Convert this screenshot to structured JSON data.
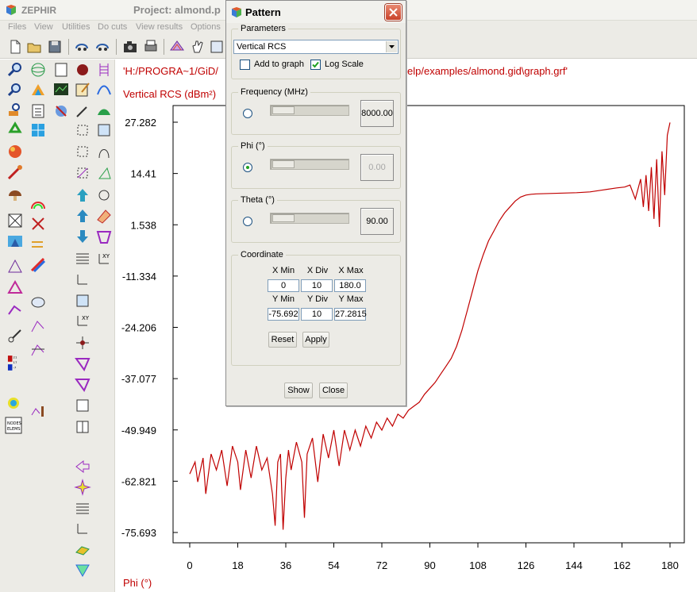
{
  "app": {
    "name": "ZEPHIR",
    "project_title": "Project: almond.p"
  },
  "menu": [
    "Files",
    "View",
    "Utilities",
    "Do cuts",
    "View results",
    "Options"
  ],
  "graph": {
    "path_prefix": "'H:/PROGRA~1/GiD/",
    "path_suffix": "elp/examples/almond.gid\\graph.grf'",
    "ylabel": "Vertical RCS (dBm²)",
    "xlabel": "Phi (°)",
    "line_color": "#c00000"
  },
  "dialog": {
    "title": "Pattern",
    "parameters_label": "Parameters",
    "parameter_selected": "Vertical RCS",
    "add_to_graph_label": "Add to graph",
    "add_to_graph_checked": false,
    "log_scale_label": "Log Scale",
    "log_scale_checked": true,
    "frequency_label": "Frequency (MHz)",
    "frequency_value": "8000.00",
    "phi_label": "Phi (°)",
    "phi_value": "0.00",
    "theta_label": "Theta (°)",
    "theta_value": "90.00",
    "coordinate_label": "Coordinate",
    "xmin_label": "X Min",
    "xdiv_label": "X Div",
    "xmax_label": "X Max",
    "xmin": "0",
    "xdiv": "10",
    "xmax": "180.0",
    "ymin_label": "Y Min",
    "ydiv_label": "Y Div",
    "ymax_label": "Y Max",
    "ymin": "-75.692",
    "ydiv": "10",
    "ymax": "27.2815",
    "reset_label": "Reset",
    "apply_label": "Apply",
    "show_label": "Show",
    "close_label": "Close"
  },
  "chart_data": {
    "type": "line",
    "title": "",
    "xlabel": "Phi (°)",
    "ylabel": "Vertical RCS (dBm²)",
    "xlim": [
      0,
      180
    ],
    "ylim": [
      -75.693,
      27.282
    ],
    "x_ticks": [
      "0",
      "18",
      "36",
      "54",
      "72",
      "90",
      "108",
      "126",
      "144",
      "162",
      "180"
    ],
    "y_ticks": [
      "27.282",
      "14.41",
      "1.538",
      "-11.334",
      "-24.206",
      "-37.077",
      "-49.949",
      "-62.821",
      "-75.693"
    ],
    "grid": false,
    "series": [
      {
        "color": "#c00000",
        "x": [
          0,
          2,
          3,
          5,
          6,
          8,
          10,
          12,
          14,
          16,
          18,
          19,
          21,
          23,
          25,
          27,
          29,
          31,
          32,
          33,
          34,
          35,
          36,
          37,
          38,
          40,
          42,
          43,
          44,
          46,
          48,
          50,
          52,
          54,
          56,
          58,
          60,
          62,
          64,
          66,
          68,
          70,
          72,
          74,
          76,
          78,
          80,
          82,
          84,
          86,
          88,
          90,
          92,
          94,
          96,
          98,
          100,
          102,
          104,
          106,
          108,
          110,
          112,
          114,
          116,
          118,
          120,
          122,
          124,
          126,
          128,
          130,
          135,
          140,
          145,
          150,
          155,
          160,
          163,
          165,
          167,
          169,
          170,
          171,
          172,
          173,
          174,
          175,
          176,
          177,
          178,
          179,
          180
        ],
        "y": [
          -61,
          -58,
          -63,
          -57,
          -66,
          -56,
          -60,
          -55,
          -64,
          -54,
          -58,
          -65,
          -55,
          -62,
          -54,
          -60,
          -57,
          -66,
          -74,
          -58,
          -56,
          -75,
          -62,
          -55,
          -60,
          -53,
          -58,
          -72,
          -56,
          -52,
          -63,
          -51,
          -57,
          -50,
          -59,
          -50,
          -55,
          -50,
          -54,
          -49,
          -52,
          -48,
          -50,
          -47,
          -49,
          -46,
          -47,
          -45,
          -44,
          -43,
          -41,
          -39.5,
          -38,
          -36,
          -34,
          -32,
          -29,
          -25,
          -20,
          -15,
          -10,
          -6,
          -2.5,
          0,
          2.5,
          4.5,
          6,
          7.5,
          8.5,
          9,
          9.2,
          9.3,
          9.4,
          9.5,
          9.6,
          9.8,
          10.3,
          10.8,
          11,
          11.5,
          8,
          13,
          6,
          14,
          5,
          16,
          3,
          18,
          1,
          20,
          9,
          24,
          27.2
        ]
      }
    ]
  }
}
